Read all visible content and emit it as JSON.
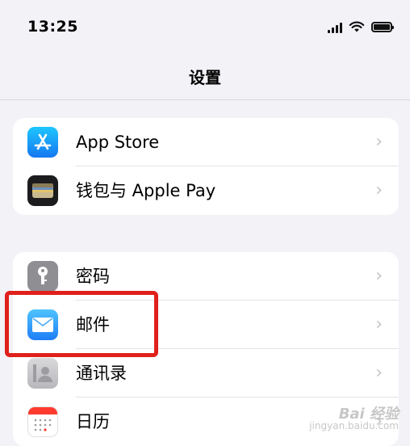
{
  "status_bar": {
    "time": "13:25"
  },
  "nav": {
    "title": "设置"
  },
  "groups": [
    {
      "items": [
        {
          "label": "App Store",
          "icon": "app-store-icon"
        },
        {
          "label": "钱包与 Apple Pay",
          "icon": "wallet-icon"
        }
      ]
    },
    {
      "items": [
        {
          "label": "密码",
          "icon": "key-icon"
        },
        {
          "label": "邮件",
          "icon": "mail-icon"
        },
        {
          "label": "通讯录",
          "icon": "contacts-icon"
        },
        {
          "label": "日历",
          "icon": "calendar-icon"
        }
      ]
    }
  ],
  "chevron": "›",
  "watermark": {
    "brand": "Bai 经验",
    "url": "jingyan.baidu.com"
  },
  "colors": {
    "highlight": "#e0201b",
    "background": "#f2f2f7",
    "card": "#ffffff"
  }
}
